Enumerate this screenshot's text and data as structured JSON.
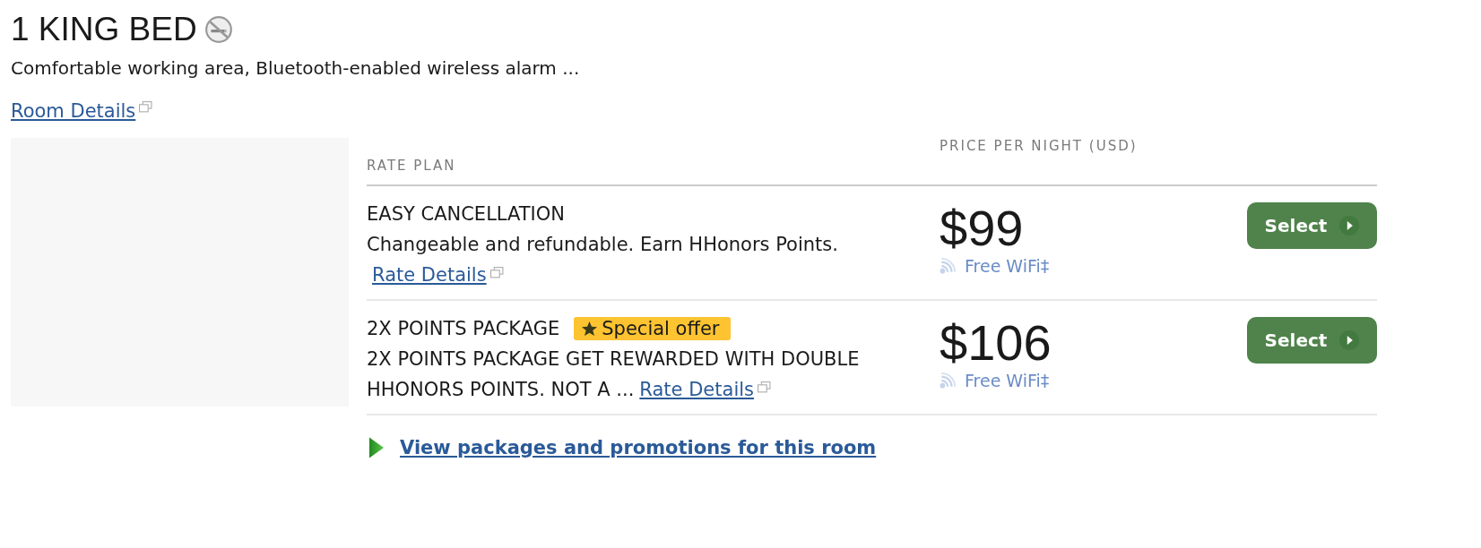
{
  "room": {
    "title": "1 KING BED",
    "non_smoking": true,
    "description": "Comfortable working area, Bluetooth-enabled wireless alarm ...",
    "details_link": "Room Details"
  },
  "rates": {
    "columns": [
      "RATE PLAN",
      "PRICE PER NIGHT (USD)"
    ],
    "rows": [
      {
        "name": "EASY CANCELLATION",
        "badge": null,
        "description": "Changeable and refundable. Earn HHonors Points.",
        "details_link": "Rate Details",
        "price": "$99",
        "amenity": "Free WiFi‡",
        "button": "Select"
      },
      {
        "name": "2X POINTS PACKAGE",
        "badge": "Special offer",
        "description": "2X POINTS PACKAGE GET REWARDED WITH DOUBLE HHONORS POINTS. NOT A ...",
        "details_link": "Rate Details",
        "price": "$106",
        "amenity": "Free WiFi‡",
        "button": "Select"
      }
    ]
  },
  "packages_link": "View packages and promotions for this room"
}
